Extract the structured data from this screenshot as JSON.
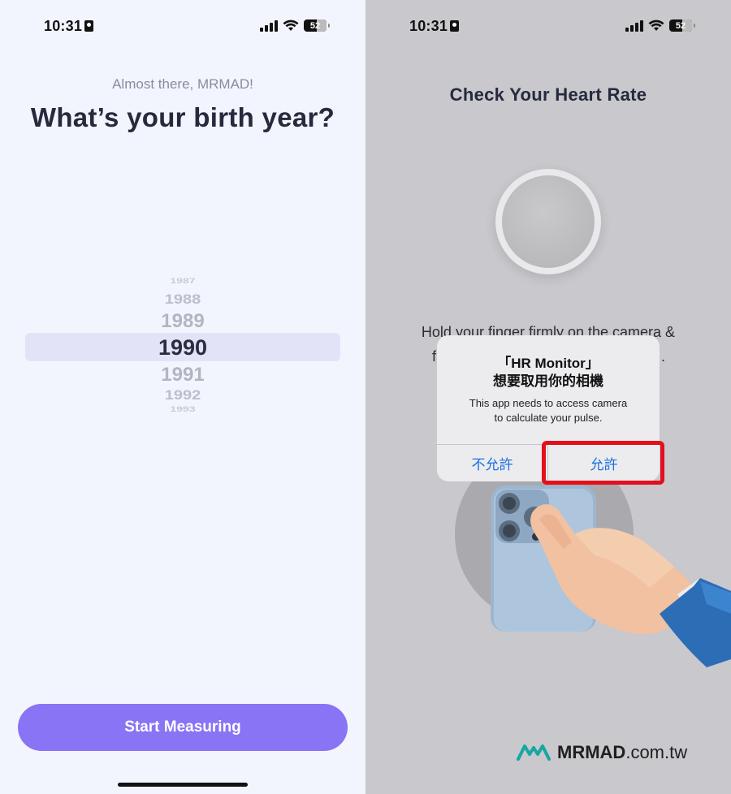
{
  "left": {
    "status": {
      "time": "10:31",
      "battery": "52"
    },
    "subtitle": "Almost there, MRMAD!",
    "headline": "What’s your birth year?",
    "picker": {
      "years_above": [
        "1987",
        "1988",
        "1989"
      ],
      "selected": "1990",
      "years_below": [
        "1991",
        "1992",
        "1993"
      ]
    },
    "cta_label": "Start Measuring"
  },
  "right": {
    "status": {
      "time": "10:31",
      "battery": "52"
    },
    "title": "Check Your Heart Rate",
    "instruction_line1": "Hold your finger firmly on the camera &",
    "instruction_line2_start": "f",
    "instruction_line2_end": ".",
    "alert": {
      "title_line1": "「HR Monitor」",
      "title_line2": "想要取用你的相機",
      "message_line1": "This app needs to access camera",
      "message_line2": "to calculate your pulse.",
      "deny_label": "不允許",
      "allow_label": "允許"
    },
    "watermark": {
      "brand": "MRMAD",
      "domain": ".com.tw"
    }
  },
  "colors": {
    "accent": "#8874f4",
    "picker_highlight": "#e3e3f8",
    "alert_button": "#1b6fe0",
    "annotation_red": "#e3101c",
    "logo_teal": "#17a7a0"
  },
  "icons": [
    "person-badge-icon",
    "cellular-signal-icon",
    "wifi-icon",
    "battery-icon",
    "mrmad-logo-icon"
  ]
}
